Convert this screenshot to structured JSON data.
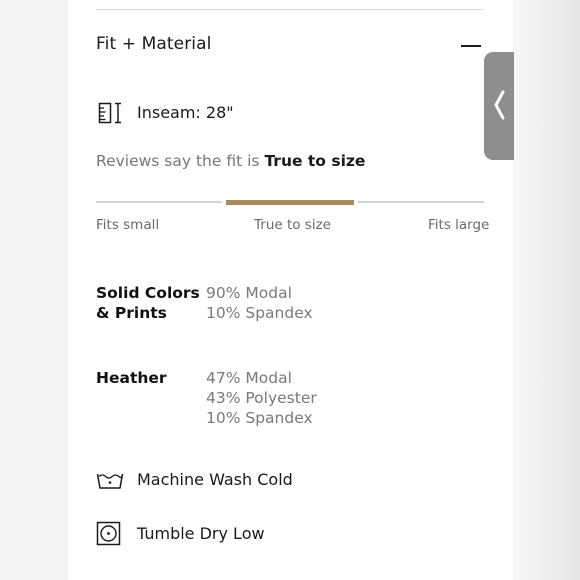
{
  "section": {
    "title": "Fit + Material",
    "toggle_icon": "minus-icon"
  },
  "side_tab": {
    "icon": "chevron-left-icon"
  },
  "inseam": {
    "icon": "ruler-icon",
    "text": "Inseam: 28\""
  },
  "reviews": {
    "prefix": "Reviews say the fit is",
    "verdict": "True to size"
  },
  "fit_scale": {
    "labels": [
      "Fits small",
      "True to size",
      "Fits large"
    ],
    "active_index": 1,
    "accent_color": "#a58a62"
  },
  "materials": [
    {
      "name_lines": [
        "Solid Colors",
        "& Prints"
      ],
      "values": [
        "90% Modal",
        "10% Spandex"
      ]
    },
    {
      "name_lines": [
        "Heather"
      ],
      "values": [
        "47% Modal",
        "43% Polyester",
        "10% Spandex"
      ]
    }
  ],
  "care": [
    {
      "icon": "wash-tub-icon",
      "text": "Machine Wash Cold"
    },
    {
      "icon": "tumble-dry-icon",
      "text": "Tumble Dry Low"
    }
  ]
}
